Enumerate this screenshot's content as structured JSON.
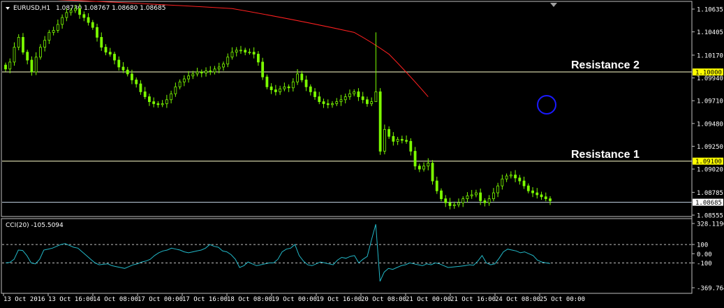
{
  "header": {
    "symbol_label": "EURUSD,H1",
    "ohlc_label": "1.08730 1.08767 1.08680 1.08685"
  },
  "indicator": {
    "label": "CCI(20) -105.5094"
  },
  "annotations": {
    "resistance2": "Resistance 2",
    "resistance1": "Resistance 1"
  },
  "colors": {
    "bull_candle": "#7CFC00",
    "moving_average": "#ff2020",
    "level_line": "#ffffcc",
    "cci_line": "#22b8c8",
    "highlight_circle": "#1a1aff",
    "price_tag_bg": "#ffff00"
  },
  "icons": {
    "dropdown": "triangle-down-icon",
    "scroll_marker": "triangle-down-icon"
  },
  "chart_data": [
    {
      "type": "candlestick",
      "title": "",
      "ylim": [
        1.08555,
        1.10635
      ],
      "y_ticks": [
        "1.10635",
        "1.10405",
        "1.10170",
        "1.09940",
        "1.09710",
        "1.09480",
        "1.09250",
        "1.09020",
        "1.08785",
        "1.08555"
      ],
      "x_ticks": [
        "13 Oct 2016",
        "13 Oct 16:00",
        "14 Oct 08:00",
        "17 Oct 00:00",
        "17 Oct 16:00",
        "18 Oct 08:00",
        "19 Oct 00:00",
        "19 Oct 16:00",
        "20 Oct 08:00",
        "21 Oct 00:00",
        "21 Oct 16:00",
        "24 Oct 08:00",
        "25 Oct 00:00"
      ],
      "levels": [
        {
          "value": 1.1,
          "label": "1.10000",
          "annotation": "Resistance 2"
        },
        {
          "value": 1.091,
          "label": "1.09100",
          "annotation": "Resistance 1"
        },
        {
          "value": 1.08685,
          "label": "1.08685"
        }
      ],
      "price_path": [
        1.1003,
        1.101,
        1.1025,
        1.1035,
        1.102,
        1.1012,
        1.1,
        1.1015,
        1.1025,
        1.1032,
        1.104,
        1.1042,
        1.1048,
        1.1055,
        1.106,
        1.1062,
        1.1064,
        1.1058,
        1.1055,
        1.105,
        1.1045,
        1.1035,
        1.1025,
        1.102,
        1.1018,
        1.1012,
        1.1005,
        1.1002,
        1.0998,
        1.0992,
        1.0988,
        1.098,
        1.0975,
        1.097,
        1.0968,
        1.0967,
        1.0968,
        1.0972,
        1.0978,
        1.0985,
        1.099,
        1.0993,
        1.0996,
        1.0998,
        1.1,
        1.0999,
        1.1001,
        1.1,
        1.1003,
        1.1005,
        1.1008,
        1.1015,
        1.102,
        1.1022,
        1.1022,
        1.102,
        1.102,
        1.1018,
        1.101,
        1.0995,
        1.0985,
        1.0982,
        1.098,
        1.0983,
        1.0985,
        1.0984,
        1.099,
        1.0998,
        1.0992,
        1.0985,
        1.098,
        1.0975,
        1.097,
        1.0968,
        1.0967,
        1.0968,
        1.097,
        1.0972,
        1.0975,
        1.0978,
        1.098,
        1.0975,
        1.0972,
        1.0968,
        1.097,
        1.098,
        1.092,
        1.0942,
        1.0935,
        1.093,
        1.0932,
        1.0931,
        1.093,
        1.092,
        1.0905,
        1.0902,
        1.0905,
        1.0908,
        1.089,
        1.088,
        1.0872,
        1.0868,
        1.0865,
        1.0866,
        1.0868,
        1.0872,
        1.0875,
        1.0876,
        1.0878,
        1.087,
        1.0868,
        1.0872,
        1.0878,
        1.0885,
        1.0892,
        1.0895,
        1.0896,
        1.0893,
        1.089,
        1.0885,
        1.088,
        1.0878,
        1.0876,
        1.0874,
        1.0872,
        1.087
      ],
      "spike": {
        "index": 85,
        "high": 1.104,
        "low": 1.0975
      },
      "moving_average": {
        "points": [
          [
            0,
            1.1075
          ],
          [
            52,
            1.1064
          ],
          [
            80,
            1.104
          ],
          [
            88,
            1.1018
          ],
          [
            97,
            1.0975
          ]
        ]
      }
    },
    {
      "type": "line",
      "title": "",
      "ylim": [
        -369.7643,
        328.1196
      ],
      "y_ticks": [
        "328.1196",
        "100",
        "0.00",
        "-100",
        "-369.7643"
      ],
      "dashed_levels": [
        100,
        -100
      ],
      "values": [
        -100,
        -95,
        -60,
        40,
        35,
        -20,
        -100,
        -110,
        -60,
        40,
        50,
        60,
        80,
        100,
        110,
        90,
        70,
        60,
        20,
        -20,
        -60,
        -100,
        -120,
        -115,
        -110,
        -130,
        -140,
        -150,
        -160,
        -140,
        -120,
        -110,
        -90,
        -80,
        -60,
        -20,
        10,
        30,
        40,
        60,
        50,
        40,
        20,
        10,
        20,
        30,
        40,
        60,
        100,
        80,
        70,
        30,
        20,
        -10,
        -60,
        -150,
        -130,
        -90,
        -110,
        -130,
        -120,
        -110,
        -100,
        -100,
        -60,
        20,
        50,
        60,
        100,
        -20,
        -80,
        -120,
        -130,
        -110,
        -90,
        -100,
        -110,
        -120,
        -70,
        -40,
        -50,
        -30,
        -20,
        -100,
        -60,
        -30,
        150,
        320,
        -300,
        -200,
        -160,
        -170,
        -150,
        -130,
        -120,
        -100,
        -110,
        -120,
        -130,
        -110,
        -120,
        -100,
        -110,
        -130,
        -150,
        -145,
        -140,
        -135,
        -130,
        -120,
        -125,
        -80,
        -20,
        -100,
        -120,
        -110,
        -50,
        20,
        50,
        40,
        30,
        10,
        20,
        0,
        -20,
        -70,
        -90,
        -100,
        -105.5094
      ]
    }
  ]
}
